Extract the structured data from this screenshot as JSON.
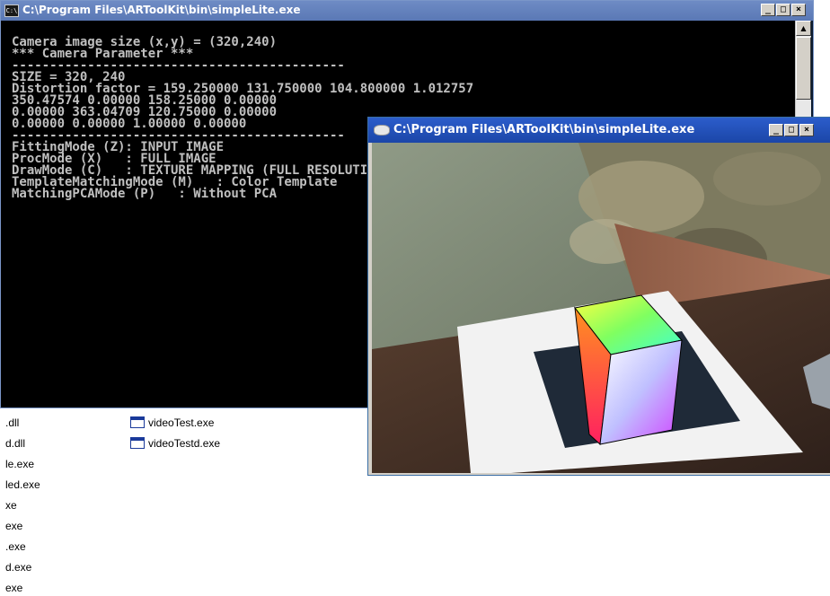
{
  "console": {
    "title": "C:\\Program Files\\ARToolKit\\bin\\simpleLite.exe",
    "icon_label": "C:\\",
    "lines": [
      "Camera image size (x,y) = (320,240)",
      "*** Camera Parameter ***",
      "--------------------------------------------",
      "SIZE = 320, 240",
      "Distortion factor = 159.250000 131.750000 104.800000 1.012757",
      "350.47574 0.00000 158.25000 0.00000",
      "0.00000 363.04709 120.75000 0.00000",
      "0.00000 0.00000 1.00000 0.00000",
      "--------------------------------------------",
      "FittingMode (Z): INPUT IMAGE",
      "ProcMode (X)   : FULL IMAGE",
      "DrawMode (C)   : TEXTURE MAPPING (FULL RESOLUTION)",
      "TemplateMatchingMode (M)   : Color Template",
      "MatchingPCAMode (P)   : Without PCA"
    ],
    "buttons": {
      "minimize": "_",
      "maximize": "□",
      "close": "×"
    }
  },
  "ar_window": {
    "title": "C:\\Program Files\\ARToolKit\\bin\\simpleLite.exe",
    "buttons": {
      "minimize": "_",
      "maximize": "□",
      "close": "×"
    }
  },
  "explorer": {
    "files_col1": [
      ".dll",
      "d.dll",
      "le.exe",
      "led.exe",
      "xe",
      "exe",
      ".exe",
      "d.exe",
      "exe"
    ],
    "files_col2": [
      "videoTest.exe",
      "videoTestd.exe"
    ]
  }
}
